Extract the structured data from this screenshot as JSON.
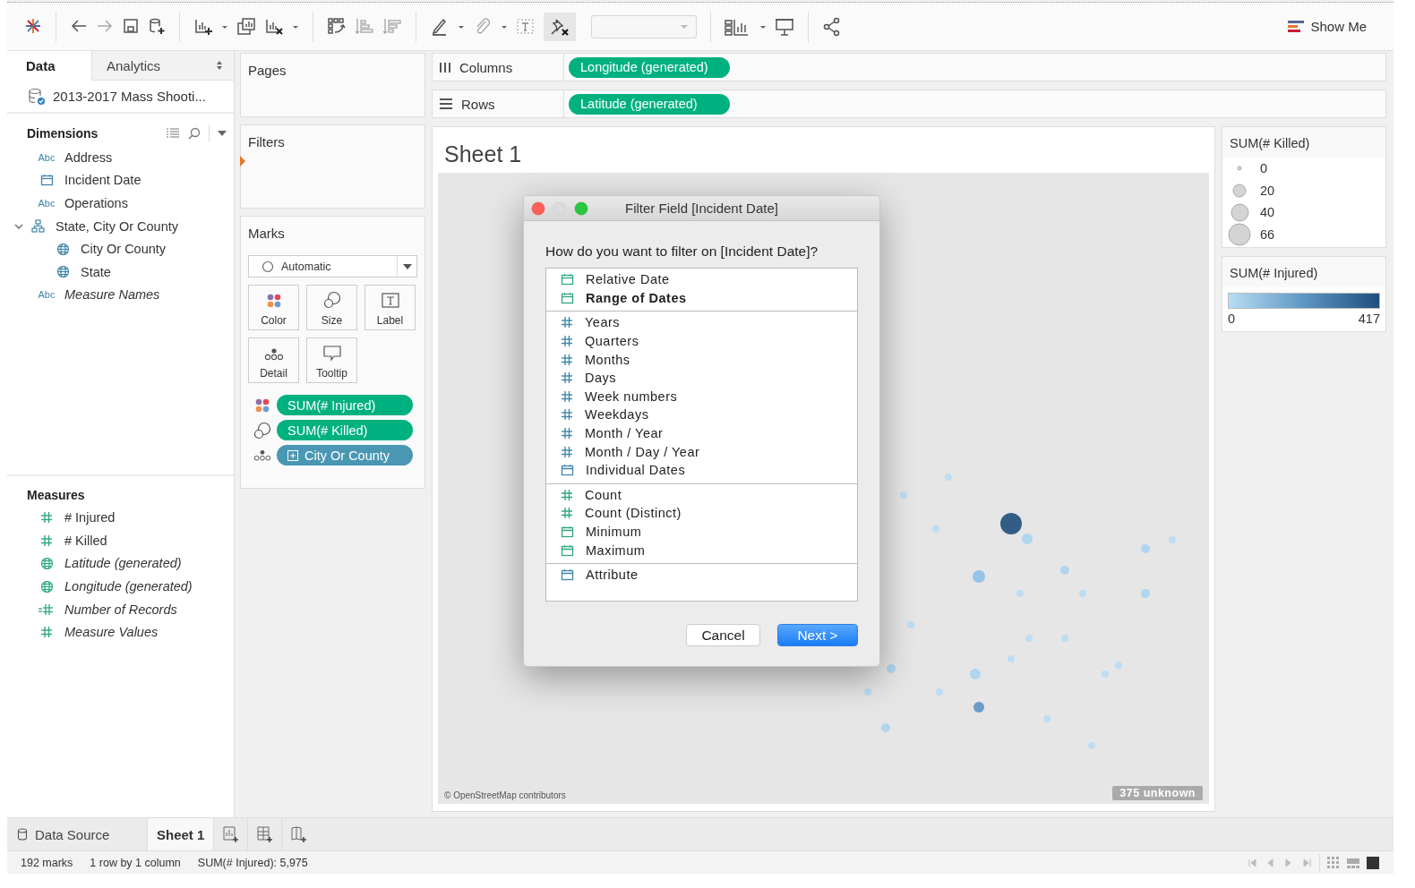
{
  "toolbar": {
    "show_me": "Show Me"
  },
  "data_pane": {
    "tabs": [
      {
        "label": "Data",
        "selected": true
      },
      {
        "label": "Analytics",
        "selected": false
      }
    ],
    "data_source": "2013-2017 Mass Shooti...",
    "dimensions": {
      "title": "Dimensions",
      "items": [
        {
          "kind": "string",
          "badge": "Abc",
          "label": "Address",
          "generated": false
        },
        {
          "kind": "date",
          "label": "Incident Date",
          "generated": false
        },
        {
          "kind": "string",
          "badge": "Abc",
          "label": "Operations",
          "generated": false
        },
        {
          "kind": "hierarchy",
          "label": "State, City Or County",
          "generated": false,
          "expanded": true,
          "children": [
            {
              "kind": "geo",
              "label": "City Or County",
              "generated": false
            },
            {
              "kind": "geo",
              "label": "State",
              "generated": false
            }
          ]
        },
        {
          "kind": "string",
          "badge": "Abc",
          "label": "Measure Names",
          "generated": true
        }
      ]
    },
    "measures": {
      "title": "Measures",
      "items": [
        {
          "kind": "number",
          "label": "# Injured",
          "generated": false
        },
        {
          "kind": "number",
          "label": "# Killed",
          "generated": false
        },
        {
          "kind": "geo",
          "label": "Latitude (generated)",
          "generated": true
        },
        {
          "kind": "geo",
          "label": "Longitude (generated)",
          "generated": true
        },
        {
          "kind": "records",
          "label": "Number of Records",
          "generated": true
        },
        {
          "kind": "number",
          "label": "Measure Values",
          "generated": true
        }
      ]
    }
  },
  "pages": {
    "title": "Pages"
  },
  "filters": {
    "title": "Filters"
  },
  "marks": {
    "title": "Marks",
    "mark_type": "Automatic",
    "cards": [
      {
        "kind": "color",
        "label": "Color"
      },
      {
        "kind": "size",
        "label": "Size"
      },
      {
        "kind": "label",
        "label": "Label"
      },
      {
        "kind": "detail",
        "label": "Detail"
      },
      {
        "kind": "tooltip",
        "label": "Tooltip"
      }
    ],
    "pills": [
      {
        "kind": "color",
        "label": "SUM(# Injured)",
        "continuous": true
      },
      {
        "kind": "size",
        "label": "SUM(# Killed)",
        "continuous": true
      },
      {
        "kind": "detail",
        "label": "City Or County",
        "continuous": false,
        "expandable": true
      }
    ]
  },
  "columns": {
    "label": "Columns",
    "pill": "Longitude (generated)"
  },
  "rows": {
    "label": "Rows",
    "pill": "Latitude (generated)"
  },
  "sheet": {
    "title": "Sheet 1",
    "attribution": "© OpenStreetMap contributors",
    "unknown": "375 unknown"
  },
  "legends": {
    "size": {
      "title": "SUM(# Killed)",
      "items": [
        "0",
        "20",
        "40",
        "66"
      ]
    },
    "color": {
      "title": "SUM(# Injured)",
      "min": "0",
      "max": "417"
    }
  },
  "dialog": {
    "title": "Filter Field [Incident Date]",
    "question": "How do you want to filter on [Incident Date]?",
    "groups": [
      [
        {
          "kind": "date",
          "continuous": true,
          "label": "Relative Date",
          "selected": false
        },
        {
          "kind": "date",
          "continuous": true,
          "label": "Range of Dates",
          "selected": true
        }
      ],
      [
        {
          "kind": "number",
          "continuous": false,
          "label": "Years",
          "selected": false
        },
        {
          "kind": "number",
          "continuous": false,
          "label": "Quarters",
          "selected": false
        },
        {
          "kind": "number",
          "continuous": false,
          "label": "Months",
          "selected": false
        },
        {
          "kind": "number",
          "continuous": false,
          "label": "Days",
          "selected": false
        },
        {
          "kind": "number",
          "continuous": false,
          "label": "Week numbers",
          "selected": false
        },
        {
          "kind": "number",
          "continuous": false,
          "label": "Weekdays",
          "selected": false
        },
        {
          "kind": "number",
          "continuous": false,
          "label": "Month / Year",
          "selected": false
        },
        {
          "kind": "number",
          "continuous": false,
          "label": "Month / Day / Year",
          "selected": false
        },
        {
          "kind": "date",
          "continuous": false,
          "label": "Individual Dates",
          "selected": false
        }
      ],
      [
        {
          "kind": "number",
          "continuous": true,
          "label": "Count",
          "selected": false
        },
        {
          "kind": "number",
          "continuous": true,
          "label": "Count (Distinct)",
          "selected": false
        },
        {
          "kind": "date",
          "continuous": true,
          "label": "Minimum",
          "selected": false
        },
        {
          "kind": "date",
          "continuous": true,
          "label": "Maximum",
          "selected": false
        }
      ],
      [
        {
          "kind": "date",
          "continuous": false,
          "label": "Attribute",
          "selected": false
        }
      ]
    ],
    "buttons": [
      {
        "label": "Cancel",
        "default": false
      },
      {
        "label": "Next >",
        "default": true
      }
    ]
  },
  "sheet_tabs": [
    {
      "kind": "datasource",
      "label": "Data Source",
      "selected": false
    },
    {
      "kind": "sheet",
      "label": "Sheet 1",
      "selected": true
    }
  ],
  "status_bar": [
    "192 marks",
    "1 row by 1 column",
    "SUM(# Injured): 5,975"
  ]
}
